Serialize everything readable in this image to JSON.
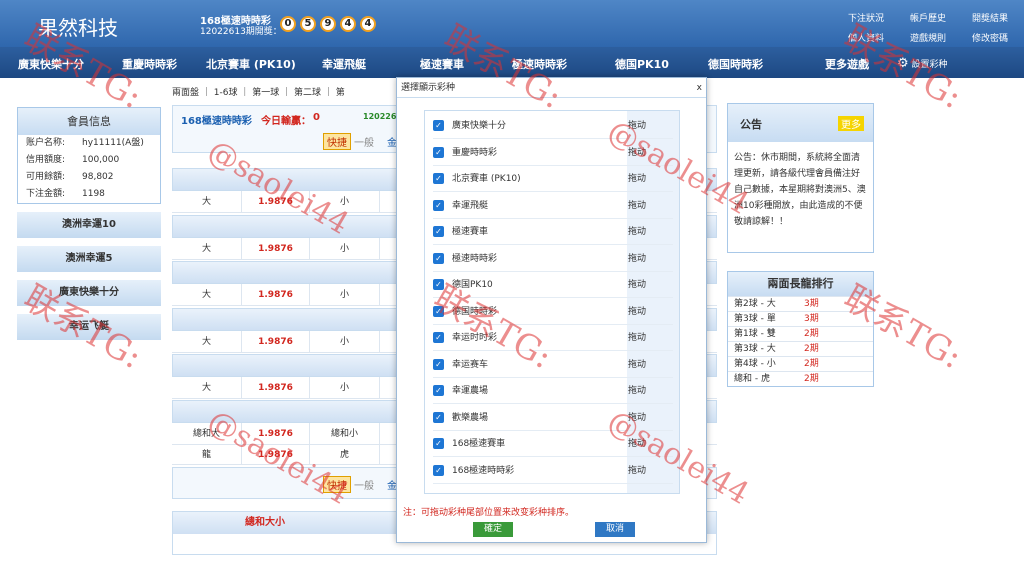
{
  "header": {
    "logo": "果然科技",
    "draw_name": "168極速時時彩",
    "draw_issue": "12022613期開獎：",
    "balls": [
      "0",
      "5",
      "9",
      "4",
      "4"
    ],
    "links_top": [
      "下注狀況",
      "帳戶歷史",
      "開獎結果"
    ],
    "links_bottom": [
      "個人資料",
      "遊戲規則",
      "修改密碼"
    ]
  },
  "nav": {
    "items": [
      "廣東快樂十分",
      "重慶時時彩",
      "北京賽車 (PK10)",
      "幸運飛艇",
      "極速賽車",
      "極速時時彩",
      "德国PK10",
      "德国時時彩",
      "更多遊戲"
    ],
    "settings": "設置彩种"
  },
  "account": {
    "title": "會員信息",
    "rows": [
      [
        "账户名称:",
        "hy11111(A盤)"
      ],
      [
        "信用額度:",
        "100,000"
      ],
      [
        "可用餘額:",
        "98,802"
      ],
      [
        "下注金額:",
        "1198"
      ]
    ]
  },
  "left_games": [
    "澳洲幸運10",
    "澳洲幸運5",
    "廣東快樂十分",
    "幸运飞艇"
  ],
  "main": {
    "game": "168極速時時彩",
    "today_label": "今日輸贏：",
    "today_value": "0",
    "issue": "120226",
    "tabs": [
      "兩面盤",
      "1-6球",
      "第一球",
      "第二球",
      "第"
    ],
    "quick": "快捷",
    "normal": "一般",
    "amount": "金",
    "rows": [
      [
        "大",
        "1.9876",
        "小"
      ],
      [
        "大",
        "1.9876",
        "小"
      ],
      [
        "大",
        "1.9876",
        "小"
      ],
      [
        "大",
        "1.9876",
        "小"
      ],
      [
        "大",
        "1.9876",
        "小"
      ],
      [
        "總和大",
        "1.9876",
        "總和小"
      ],
      [
        "龍",
        "1.9876",
        "虎"
      ]
    ],
    "bottom_title": "總和大小"
  },
  "notice": {
    "title": "公告",
    "more": "更多",
    "text": "公告：休市期間，系統將全面清理更新，請各級代理會員備注好自己數據，本星期將對澳洲5、澳洲10彩種開放，由此造成的不便敬請諒解！！"
  },
  "rank": {
    "title": "兩面長龍排行",
    "rows": [
      [
        "第2球 - 大",
        "3期"
      ],
      [
        "第3球 - 單",
        "3期"
      ],
      [
        "第1球 - 雙",
        "2期"
      ],
      [
        "第3球 - 大",
        "2期"
      ],
      [
        "第4球 - 小",
        "2期"
      ],
      [
        "總和 - 虎",
        "2期"
      ]
    ]
  },
  "modal": {
    "title": "選擇顯示彩种",
    "close": "x",
    "drag_label": "拖动",
    "items": [
      "廣東快樂十分",
      "重慶時時彩",
      "北京賽車 (PK10)",
      "幸運飛艇",
      "極速賽車",
      "極速時時彩",
      "德国PK10",
      "德国時時彩",
      "幸运时时彩",
      "幸运赛车",
      "幸運農場",
      "歡樂農場",
      "168極速賽車",
      "168極速時時彩"
    ],
    "note": "注：可拖动彩种尾部位置来改变彩种排序。",
    "confirm": "確定",
    "cancel": "取消"
  },
  "watermark": {
    "cn": "联系TG:",
    "handle": "@saolei44"
  },
  "colors": {
    "header": "#2f67ad",
    "nav": "#1d4882",
    "odds": "#d2271f",
    "confirm": "#3a9a3a",
    "cancel": "#2f78c4"
  }
}
